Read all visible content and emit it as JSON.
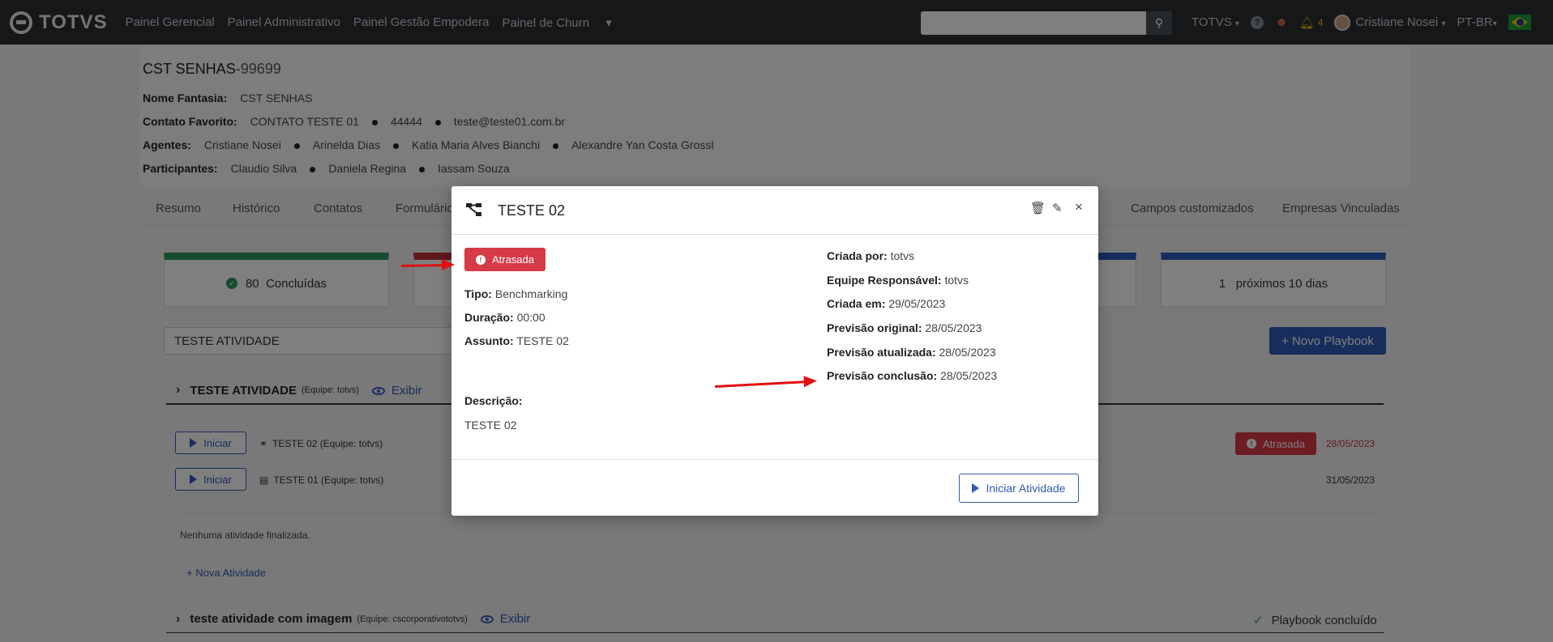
{
  "nav": {
    "brand": "TOTVS",
    "links": [
      "Painel Gerencial",
      "Painel Administrativo",
      "Painel Gestão Empodera",
      "Painel de Churn"
    ],
    "search_placeholder": "",
    "totvs_menu": "TOTVS",
    "notif_count": "4",
    "user": "Cristiane Nosei",
    "lang": "PT-BR"
  },
  "account": {
    "name": "CST SENHAS",
    "code": "-99699",
    "fantasia_label": "Nome Fantasia:",
    "fantasia": "CST SENHAS",
    "contato_label": "Contato Favorito:",
    "contato": "CONTATO TESTE 01",
    "contato_phone": "44444",
    "contato_email": "teste@teste01.com.br",
    "agentes_label": "Agentes:",
    "agentes": [
      "Cristiane Nosei",
      "Arinelda Dias",
      "Katia Maria Alves Bianchi",
      "Alexandre Yan Costa Grossl"
    ],
    "participantes_label": "Participantes:",
    "participantes": [
      "Claudio Silva",
      "Daniela Regina",
      "Iassam Souza"
    ]
  },
  "tabs": [
    "Resumo",
    "Histórico",
    "Contatos",
    "Formulário",
    "Campos customizados",
    "Empresas Vinculadas"
  ],
  "stats": {
    "concluidas": "80  Concluídas",
    "proximos": "1   próximos 10 dias",
    "colors": {
      "green": "#2d9a5f",
      "red": "#c0303a",
      "blue": "#2e5bb8"
    }
  },
  "filter_value": "TESTE ATIVIDADE",
  "novo_playbook": "+ Novo Playbook",
  "playbooks": [
    {
      "title": "TESTE ATIVIDADE",
      "team": "(Equipe: totvs)",
      "exibir": "Exibir"
    },
    {
      "title": "teste atividade com imagem",
      "team": "(Equipe: cscorporativototvs)",
      "exibir": "Exibir",
      "status": "Playbook concluído"
    }
  ],
  "activities": [
    {
      "button": "Iniciar",
      "label": "TESTE 02 (Equipe: totvs)",
      "status": "Atrasada",
      "date": "28/05/2023"
    },
    {
      "button": "Iniciar",
      "label": "TESTE 01 (Equipe: totvs)",
      "date": "31/05/2023"
    }
  ],
  "no_finished": "Nenhuma atividade finalizada.",
  "nova_atividade": "+ Nova Atividade",
  "modal": {
    "title": "TESTE 02",
    "status": "Atrasada",
    "tipo_label": "Tipo:",
    "tipo": "Benchmarking",
    "duracao_label": "Duração:",
    "duracao": "00:00",
    "assunto_label": "Assunto:",
    "assunto": "TESTE 02",
    "descricao_label": "Descrição:",
    "descricao": "TESTE 02",
    "criada_por_label": "Criada por:",
    "criada_por": "totvs",
    "equipe_label": "Equipe Responsável:",
    "equipe": "totvs",
    "criada_em_label": "Criada em:",
    "criada_em": "29/05/2023",
    "prev_original_label": "Previsão original:",
    "prev_original": "28/05/2023",
    "prev_atualizada_label": "Previsão atualizada:",
    "prev_atualizada": "28/05/2023",
    "prev_conclusao_label": "Previsão conclusão:",
    "prev_conclusao": "28/05/2023",
    "start_button": "Iniciar Atividade"
  }
}
